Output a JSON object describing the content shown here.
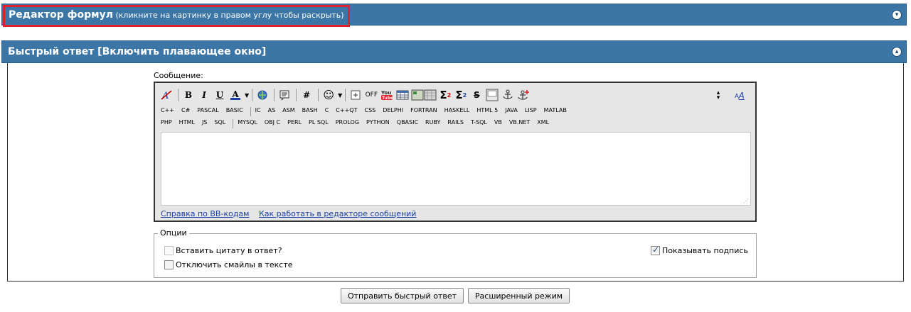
{
  "formula_header": {
    "title": "Редактор формул",
    "hint": "(кликните на картинку в правом углу чтобы раскрыть)",
    "icon": "expand-icon"
  },
  "quick_header": {
    "title": "Быстрый ответ [Включить плавающее окно]",
    "icon": "collapse-icon"
  },
  "message_label": "Сообщение:",
  "toolbar": {
    "bold": "B",
    "italic": "I",
    "underline": "U",
    "color": "A",
    "hash": "#",
    "code_c": "C",
    "off": "OFF",
    "sigma": "Σ",
    "strike": "S",
    "font_size": "A"
  },
  "languages_row1": [
    "C++",
    "C#",
    "PASCAL",
    "BASIC",
    "IC",
    "AS",
    "ASM",
    "BASH",
    "C",
    "C++QT",
    "CSS",
    "DELPHI",
    "FORTRAN",
    "HASKELL",
    "HTML 5",
    "JAVA",
    "LISP",
    "MATLAB"
  ],
  "languages_row2": [
    "PHP",
    "HTML",
    "JS",
    "SQL",
    "MYSQL",
    "OBJ C",
    "PERL",
    "PL SQL",
    "PROLOG",
    "PYTHON",
    "QBASIC",
    "RUBY",
    "RAILS",
    "T-SQL",
    "VB",
    "VB.NET",
    "XML"
  ],
  "links": {
    "bbcode_help": "Справка по BB-кодам",
    "editor_help": "Как работать в редакторе сообщений"
  },
  "options": {
    "legend": "Опции",
    "quote": {
      "label": "Вставить цитату в ответ?",
      "checked": false,
      "disabled": true
    },
    "smilies": {
      "label": "Отключить смайлы в тексте",
      "checked": false
    },
    "signature": {
      "label": "Показывать подпись",
      "checked": true
    }
  },
  "buttons": {
    "submit": "Отправить быстрый ответ",
    "advanced": "Расширенный режим"
  },
  "colors": {
    "header_bg": "#3c76a7",
    "highlight": "#e0202e",
    "link": "#1a3fa4"
  }
}
